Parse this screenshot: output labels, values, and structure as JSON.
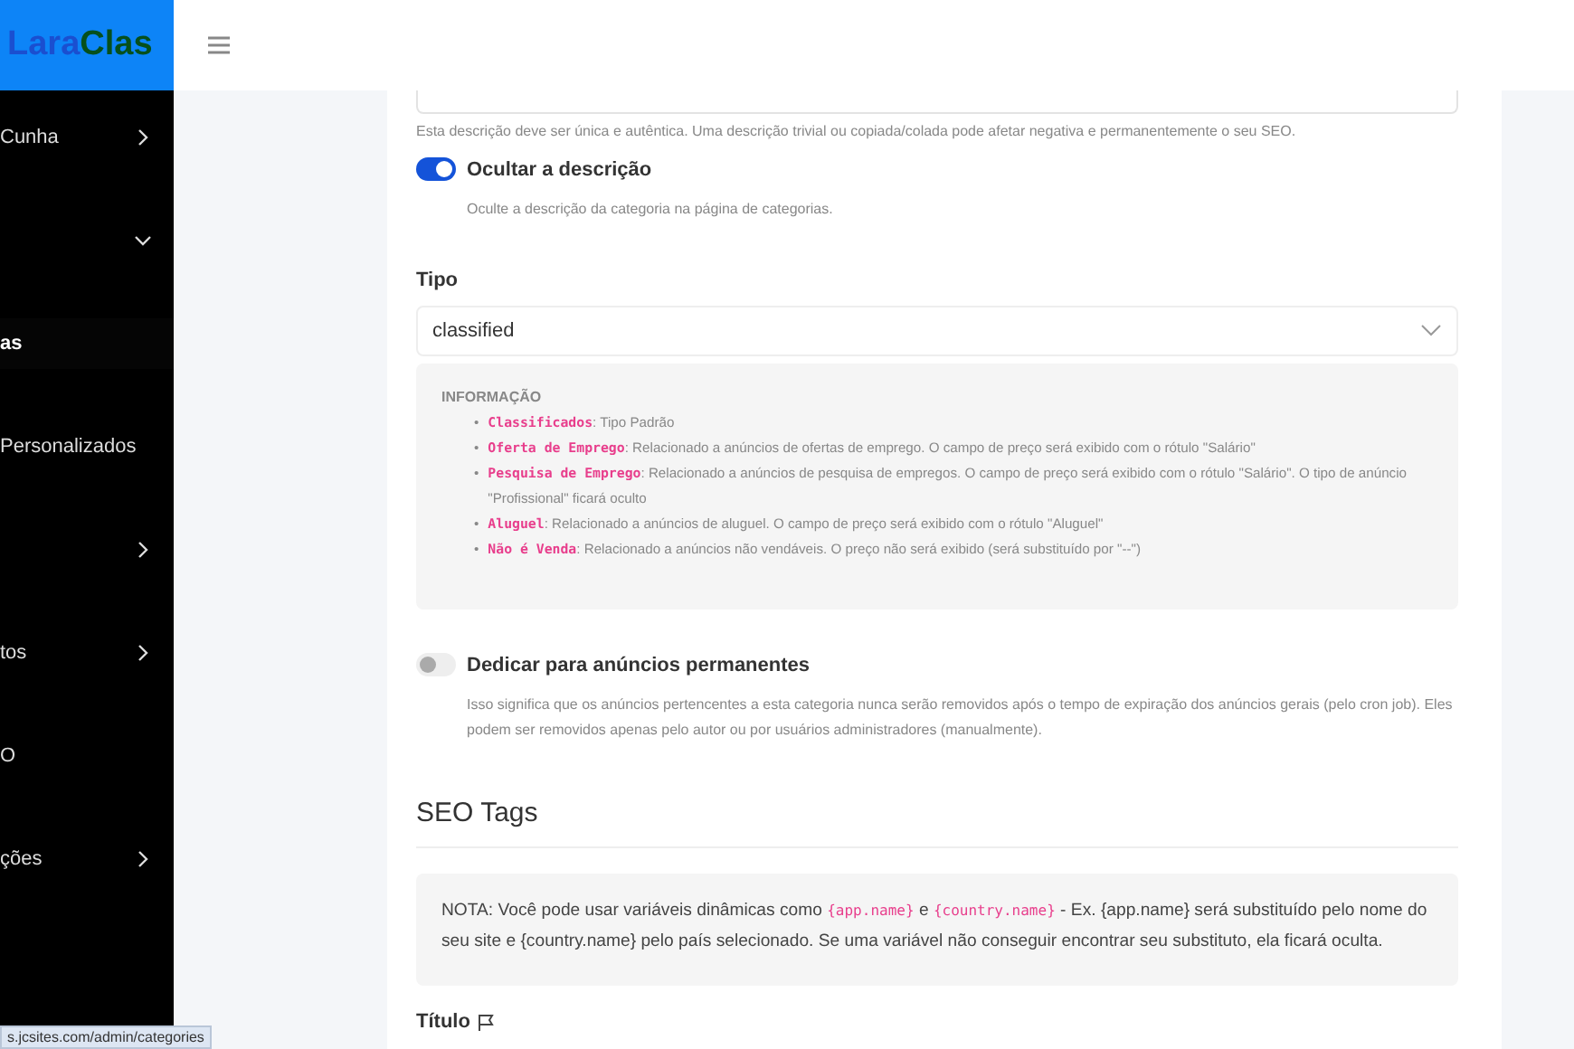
{
  "logo": {
    "part1": "Lara",
    "part2": "Clas"
  },
  "sidebar": {
    "items": [
      {
        "label": "Cunha",
        "expanded": false,
        "selected": false
      },
      {
        "expanded": true,
        "selected": false
      },
      {
        "label": "as",
        "selected": true
      },
      {
        "label": "Personalizados",
        "selected": false
      },
      {
        "expanded": false,
        "selected": false
      },
      {
        "label": "tos",
        "expanded": false,
        "selected": false
      },
      {
        "label": "O",
        "selected": false
      },
      {
        "label": "ções",
        "expanded": false,
        "selected": false
      }
    ]
  },
  "status_url": "s.jcsites.com/admin/categories",
  "description_hint": "Esta descrição deve ser única e autêntica. Uma descrição trivial ou copiada/colada pode afetar negativa e permanentemente o seu SEO.",
  "hide_description": {
    "label": "Ocultar a descrição",
    "on": true,
    "help": "Oculte a descrição da categoria na página de categorias."
  },
  "type": {
    "label": "Tipo",
    "value": "classified"
  },
  "info": {
    "title": "INFORMAÇÃO",
    "items": [
      {
        "marker": "•",
        "term": "Classificados",
        "text": ": Tipo Padrão"
      },
      {
        "marker": "•",
        "term": "Oferta de Emprego",
        "text": ": Relacionado a anúncios de ofertas de emprego. O campo de preço será exibido com o rótulo \"Salário\""
      },
      {
        "marker": "•",
        "term": "Pesquisa de Emprego",
        "text": ": Relacionado a anúncios de pesquisa de empregos. O campo de preço será exibido com o rótulo \"Salário\". O tipo de anúncio \"Profissional\" ficará oculto"
      },
      {
        "marker": "•",
        "term": "Aluguel",
        "text": ": Relacionado a anúncios de aluguel. O campo de preço será exibido com o rótulo \"Aluguel\""
      },
      {
        "marker": "•",
        "term": "Não é Venda",
        "text": ": Relacionado a anúncios não vendáveis. O preço não será exibido (será substituído por \"--\")"
      }
    ]
  },
  "permanent": {
    "label": "Dedicar para anúncios permanentes",
    "on": false,
    "help": "Isso significa que os anúncios pertencentes a esta categoria nunca serão removidos após o tempo de expiração dos anúncios gerais (pelo cron job). Eles podem ser removidos apenas pelo autor ou por usuários administradores (manualmente)."
  },
  "seo_heading": "SEO Tags",
  "note": [
    {
      "kind": "text",
      "text": "NOTA: Você pode usar variáveis dinâmicas como "
    },
    {
      "kind": "code",
      "text": "{app.name}"
    },
    {
      "kind": "text",
      "text": " e "
    },
    {
      "kind": "code",
      "text": "{country.name}"
    },
    {
      "kind": "text",
      "text": " - Ex. {app.name} será substituído pelo nome do seu site e {country.name} pelo país selecionado. Se uma variável não conseguir encontrar seu substituto, ela ficará oculta."
    }
  ],
  "title_label": "Título"
}
